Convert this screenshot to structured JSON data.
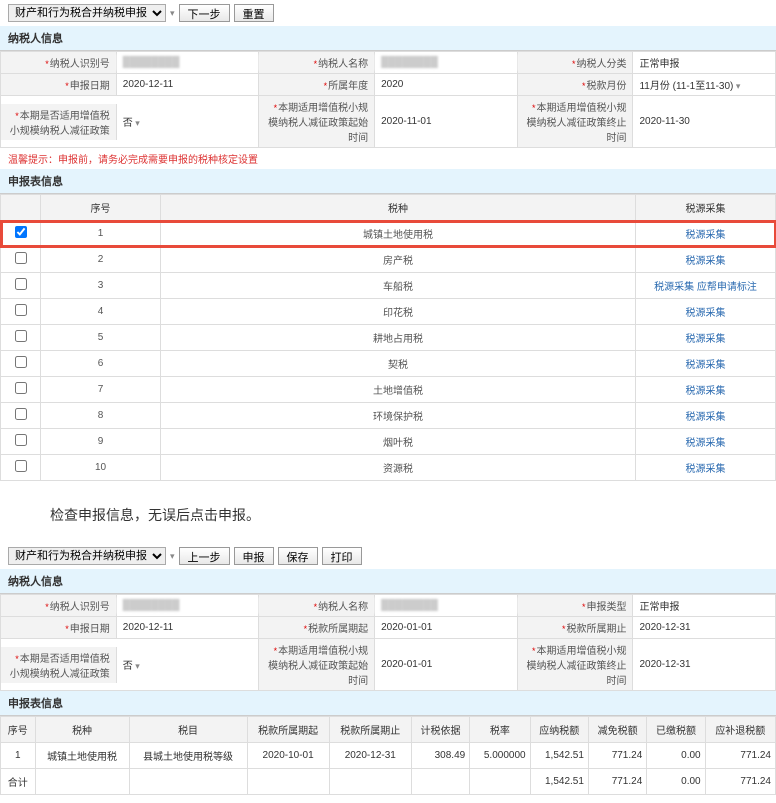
{
  "top1": {
    "dropdown": "财产和行为税合并纳税申报",
    "next_btn": "下一步",
    "reset_btn": "重置"
  },
  "taxpayer_panel_title": "纳税人信息",
  "declare_panel_title": "申报表信息",
  "info1": {
    "r1": [
      {
        "label": "纳税人识别号",
        "value": "",
        "blurred": true,
        "star": true
      },
      {
        "label": "纳税人名称",
        "value": "",
        "blurred": true,
        "star": true
      },
      {
        "label": "纳税人分类",
        "value": "正常申报",
        "star": true
      },
      {
        "label": "",
        "value": ""
      }
    ],
    "r2": [
      {
        "label": "申报日期",
        "value": "2020-12-11",
        "star": true
      },
      {
        "label": "所属年度",
        "value": "2020",
        "star": true
      },
      {
        "label": "税款月份",
        "value": "11月份 (11-1至11-30)",
        "star": true,
        "dropdown": true
      },
      {
        "label": "",
        "value": ""
      }
    ],
    "r3": [
      {
        "label": "本期是否适用增值税小规模纳税人减征政策",
        "value": "否",
        "star": true,
        "dropdown": true
      },
      {
        "label": "本期适用增值税小规模纳税人减征政策起始时间",
        "value": "2020-11-01",
        "star": true
      },
      {
        "label": "本期适用增值税小规模纳税人减征政策终止时间",
        "value": "2020-11-30",
        "star": true
      },
      {
        "label": "",
        "value": ""
      }
    ]
  },
  "warning": "温馨提示：申报前，请务必完成需要申报的税种核定设置",
  "tax_items": {
    "headers": [
      "",
      "序号",
      "税种",
      "税源采集"
    ],
    "rows": [
      {
        "checked": true,
        "seq": "1",
        "name": "城镇土地使用税",
        "links": [
          "税源采集"
        ],
        "highlight": true
      },
      {
        "checked": false,
        "seq": "2",
        "name": "房产税",
        "links": [
          "税源采集"
        ]
      },
      {
        "checked": false,
        "seq": "3",
        "name": "车船税",
        "links": [
          "税源采集",
          "应帮申请标注"
        ]
      },
      {
        "checked": false,
        "seq": "4",
        "name": "印花税",
        "links": [
          "税源采集"
        ]
      },
      {
        "checked": false,
        "seq": "5",
        "name": "耕地占用税",
        "links": [
          "税源采集"
        ]
      },
      {
        "checked": false,
        "seq": "6",
        "name": "契税",
        "links": [
          "税源采集"
        ]
      },
      {
        "checked": false,
        "seq": "7",
        "name": "土地增值税",
        "links": [
          "税源采集"
        ]
      },
      {
        "checked": false,
        "seq": "8",
        "name": "环境保护税",
        "links": [
          "税源采集"
        ]
      },
      {
        "checked": false,
        "seq": "9",
        "name": "烟叶税",
        "links": [
          "税源采集"
        ]
      },
      {
        "checked": false,
        "seq": "10",
        "name": "资源税",
        "links": [
          "税源采集"
        ]
      }
    ]
  },
  "instruction_text": "检查申报信息，无误后点击申报。",
  "top2": {
    "dropdown": "财产和行为税合并纳税申报",
    "prev_btn": "上一步",
    "declare_btn": "申报",
    "save_btn": "保存",
    "print_btn": "打印"
  },
  "info2": {
    "r1": [
      {
        "label": "纳税人识别号",
        "value": "",
        "blurred": true,
        "star": true
      },
      {
        "label": "纳税人名称",
        "value": "",
        "blurred": true,
        "star": true
      },
      {
        "label": "申报类型",
        "value": "正常申报",
        "star": true
      }
    ],
    "r2": [
      {
        "label": "申报日期",
        "value": "2020-12-11",
        "star": true
      },
      {
        "label": "税款所属期起",
        "value": "2020-01-01",
        "star": true
      },
      {
        "label": "税款所属期止",
        "value": "2020-12-31",
        "star": true
      }
    ],
    "r3": [
      {
        "label": "本期是否适用增值税小规模纳税人减征政策",
        "value": "否",
        "star": true,
        "dropdown": true
      },
      {
        "label": "本期适用增值税小规模纳税人减征政策起始时间",
        "value": "2020-01-01",
        "star": true
      },
      {
        "label": "本期适用增值税小规模纳税人减征政策终止时间",
        "value": "2020-12-31",
        "star": true
      }
    ]
  },
  "detail": {
    "headers": [
      "序号",
      "税种",
      "税目",
      "税款所属期起",
      "税款所属期止",
      "计税依据",
      "税率",
      "应纳税额",
      "减免税额",
      "已缴税额",
      "应补退税额"
    ],
    "rows": [
      {
        "seq": "1",
        "tax": "城镇土地使用税",
        "item": "县城土地使用税等级",
        "start": "2020-10-01",
        "end": "2020-12-31",
        "basis": "308.49",
        "rate": "5.000000",
        "payable": "1,542.51",
        "reduce": "771.24",
        "paid": "0.00",
        "refund": "771.24"
      }
    ],
    "total_label": "合计",
    "totals": {
      "payable": "1,542.51",
      "reduce": "771.24",
      "paid": "0.00",
      "refund": "771.24"
    }
  }
}
